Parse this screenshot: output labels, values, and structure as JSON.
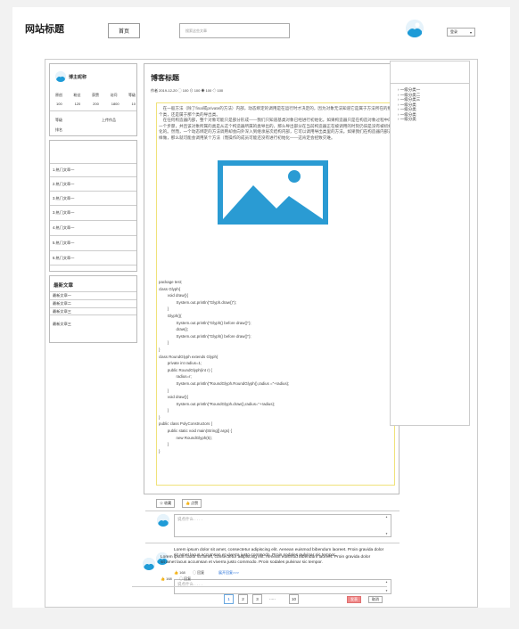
{
  "header": {
    "site_title": "网站标题",
    "home_label": "首页",
    "search_placeholder": "搜索这些文章",
    "login_label": "登录",
    "caret": "▾"
  },
  "profile": {
    "name": "博主昵称",
    "stats_labels": [
      "原创",
      "粉丝",
      "获赞",
      "访问",
      "等级"
    ],
    "stats_values": [
      "100",
      "120",
      "200",
      "1800",
      "10"
    ],
    "level_label": "等级",
    "upload_label": "上传作品",
    "rank_label": "排名"
  },
  "hot_articles": [
    "1.热门文章一",
    "2.热门文章一",
    "3.热门文章一",
    "3.热门文章一",
    "4.热门文章一",
    "5.热门文章一",
    "6.热门文章一"
  ],
  "latest": {
    "title": "最新文章",
    "items": [
      "最新文章一",
      "最新文章二",
      "最新文章三",
      "最新文章三"
    ]
  },
  "post": {
    "title": "博客标题",
    "meta": "作者  2019-12-20   ◯ 100   ⊙ 100   ◉ 100   ◇ 100",
    "paragraph": "　在一般方法（除了final或private的方法）内部，动态绑定的调用是在运行时才决定的，因为对象无法知道它是属于方法所在的那个类，还是属于那个类的导出类。\n　在任何构造器内部，整个对象可能只是部分形成——我们只知道基类对象已经进行初始化。如果构造器只是在构造对象过程中的一个步骤，并且该对象所属的类是从这个构造器所属的类导出的，那么导出部分在当前构造器正在被调用的时刻仍旧是没有被初始化的。然而，一个动态绑定的方法调用却会向外深入到继承层次结构内部，它可以调用导出类里的方法。如果我们在构造器内部这样做，那么就可能会调用某个方法（而操作的成员可能还没有进行初始化——这肯定会招致灾难。",
    "code": [
      "package test;",
      "class Glyph{",
      "        void draw(){",
      "                System.out.println(\"Glyph.draw()\");",
      "        }",
      "        Glyph(){",
      "                System.out.println(\"Glyph() before draw()\");",
      "                draw();",
      "                System.out.println(\"Glyph() before draw()\");",
      "        }",
      "}",
      "class RoundGlyph extends Glyph{",
      "        private int radius=1;",
      "        public RoundGlyph(int r) {",
      "                radius=r;",
      "                System.out.println(\"RoundGlyph.RoundGlyph(),radius =\"+radius);",
      "        }",
      "        void draw(){",
      "                System.out.println(\"RoundGlyph.draw(),radius=\"+radius);",
      "        }",
      "}",
      "public class PolyConstructors {",
      "        public static void main(String[] args) {",
      "                new RoundGlyph(5);",
      "        }",
      "}"
    ],
    "favorite_label": "☆ 收藏",
    "like_label": "👍 点赞"
  },
  "comment_box": {
    "placeholder": "说点什么 . . . .",
    "arrow_up": "▲",
    "arrow_down": "▼"
  },
  "comments": [
    {
      "text": "Lorem ipsum dolor sit amet, consectetur adipiscing elit. Aenean euismod bibendum laoreet. Proin gravida dolor sit amet lacus accumsan et viverra justo commodo. Proin sodales pulvinar sic tempor.",
      "likes": "👍 168",
      "reply": "◯ 回复",
      "expand": "展开回复>>>"
    },
    {
      "text": "Lorem ipsum dolor sit amet, consectetur adipiscing elit. Aenean euismod bibendum laoreet. Proin gravida dolor sit amet lacus accumsan et viverra justo commodo. Proin sodales pulvinar sic tempor.",
      "likes": "👍 168",
      "reply": "◯ 回复"
    }
  ],
  "reply_box": {
    "placeholder": "说点什么 . . . .",
    "submit": "发表",
    "cancel": "取消"
  },
  "pagination": {
    "pages": [
      "1",
      "2",
      "3",
      "10"
    ],
    "ellipsis": "....."
  },
  "categories": [
    "一级分类一",
    "一级分类二",
    "一级分类三",
    "一级分类",
    "一级分类",
    "一级分类",
    "一级分类"
  ],
  "colors": {
    "accent": "#1e9bd7",
    "highlight_border": "#f0e27a",
    "danger": "#f08b8b"
  }
}
